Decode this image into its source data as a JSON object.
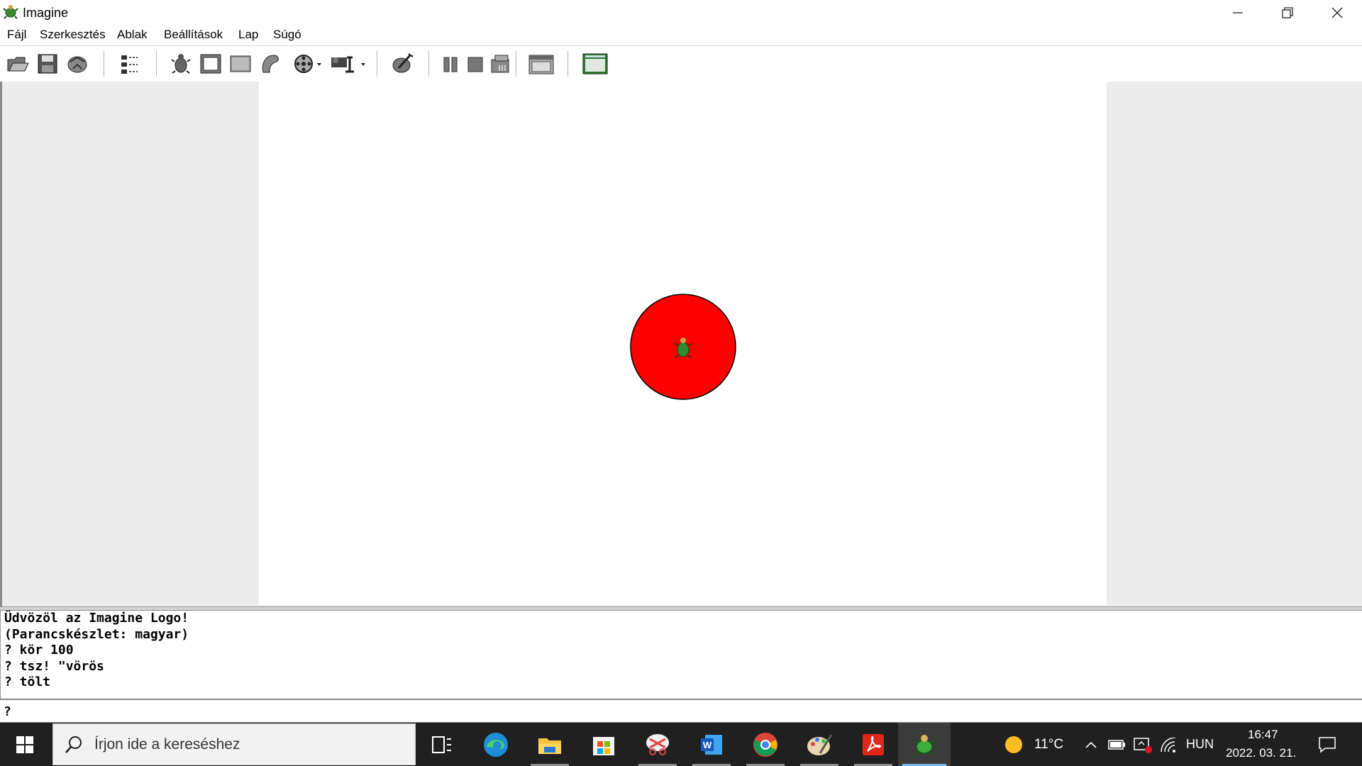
{
  "window": {
    "title": "Imagine"
  },
  "menu": {
    "items": [
      "Fájl",
      "Szerkesztés",
      "Ablak",
      "Beállítások",
      "Lap",
      "Súgó"
    ]
  },
  "toolbar": {
    "buttons": [
      "open-icon",
      "save-icon",
      "project-icon",
      "tree-icon",
      "turtle-icon",
      "frame-icon",
      "pane-icon",
      "shape-icon",
      "film-icon",
      "shape-menu-icon",
      "wand-icon",
      "pause-icon",
      "stop-icon",
      "run-icon",
      "window-icon",
      "view-icon"
    ]
  },
  "canvas": {
    "circle_color": "#ff0000"
  },
  "console": {
    "lines": [
      "Üdvözöl az Imagine Logo!",
      "(Parancskészlet: magyar)",
      "? kör 100",
      "? tsz! \"vörös",
      "? tölt"
    ]
  },
  "command": {
    "prompt": "?"
  },
  "taskbar": {
    "search_placeholder": "Írjon ide a kereséshez",
    "weather": "11°C",
    "language": "HUN",
    "time": "16:47",
    "date": "2022. 03. 21."
  },
  "colors": {
    "taskbar": "#202020",
    "circle": "#ff0000",
    "turtle": "#2e8b2e"
  }
}
